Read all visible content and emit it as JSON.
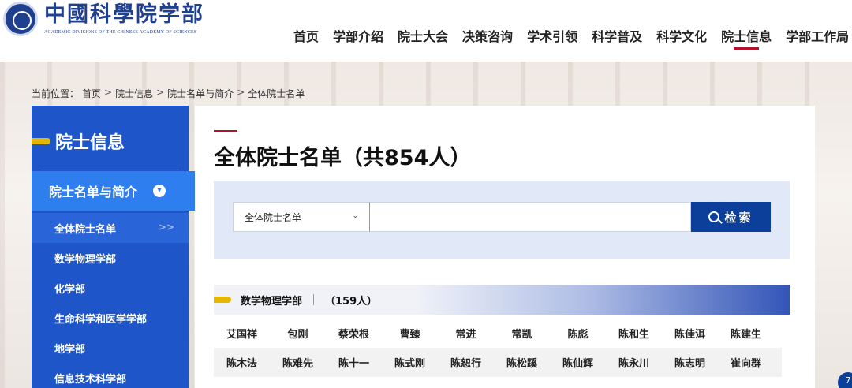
{
  "header": {
    "logo_cn": "中國科學院学部",
    "logo_en": "ACADEMIC DIVISIONS OF THE CHINESE ACADEMY OF SCIENCES",
    "nav": [
      "首页",
      "学部介绍",
      "院士大会",
      "决策咨询",
      "学术引领",
      "科学普及",
      "科学文化",
      "院士信息",
      "学部工作局"
    ],
    "active_nav": "院士信息"
  },
  "breadcrumb": {
    "prefix": "当前位置：",
    "items": [
      "首页",
      "院士信息",
      "院士名单与简介",
      "全体院士名单"
    ],
    "separator": ">"
  },
  "sidebar": {
    "title": "院士信息",
    "submenu_title": "院士名单与简介",
    "items": [
      "全体院士名单",
      "数学物理学部",
      "化学部",
      "生命科学和医学学部",
      "地学部",
      "信息技术科学部"
    ],
    "active_item": "全体院士名单",
    "active_arrow": ">>"
  },
  "main": {
    "title": "全体院士名单（共854人）",
    "search": {
      "select_value": "全体院士名单",
      "input_value": "",
      "button_label": "检索"
    },
    "section": {
      "name": "数学物理学部",
      "count": "（159人）"
    },
    "name_rows": [
      [
        "艾国祥",
        "包刚",
        "蔡荣根",
        "曹臻",
        "常进",
        "常凯",
        "陈彪",
        "陈和生",
        "陈佳洱",
        "陈建生"
      ],
      [
        "陈木法",
        "陈难先",
        "陈十一",
        "陈式刚",
        "陈恕行",
        "陈松蹊",
        "陈仙辉",
        "陈永川",
        "陈志明",
        "崔向群"
      ]
    ]
  },
  "float_button": "7",
  "colors": {
    "brand_blue": "#1e55c8",
    "accent_red": "#b3122a",
    "accent_yellow": "#e4b800",
    "button_blue": "#0c3f99"
  }
}
